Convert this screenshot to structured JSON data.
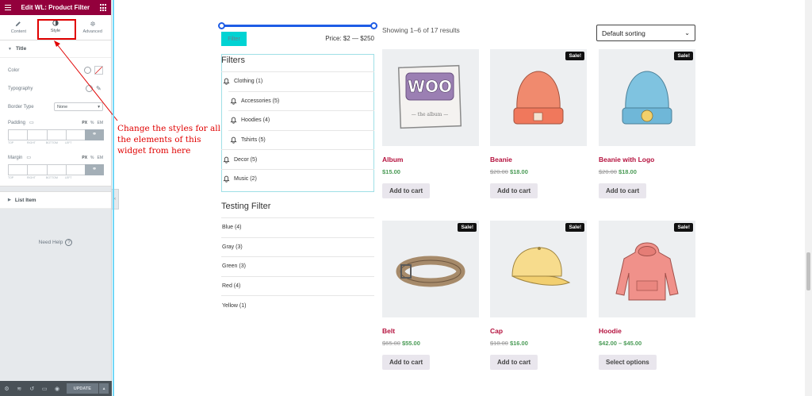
{
  "panel": {
    "title": "Edit WL: Product Filter",
    "tabs": [
      {
        "label": "Content",
        "icon": "pencil-icon"
      },
      {
        "label": "Style",
        "icon": "half-circle-icon"
      },
      {
        "label": "Advanced",
        "icon": "gear-icon"
      }
    ],
    "active_tab": "Style",
    "section_title": "Title",
    "controls": {
      "color": "Color",
      "typography": "Typography",
      "border_type": "Border Type",
      "border_value": "None",
      "padding": "Padding",
      "margin": "Margin",
      "unit_px": "PX",
      "unit_pct": "%",
      "unit_em": "EM",
      "dim_labels": [
        "TOP",
        "RIGHT",
        "BOTTOM",
        "LEFT"
      ]
    },
    "list_item": "List Item",
    "need_help": "Need Help",
    "update": "UPDATE",
    "accent": "#93003c"
  },
  "annotation": "Change the styles for all the elements of this widget from here",
  "filter": {
    "button": "Filter",
    "price": "Price: $2 — $250",
    "title": "Filters",
    "items": [
      {
        "label": "Clothing (1)",
        "sub": false
      },
      {
        "label": "Accessories (5)",
        "sub": true
      },
      {
        "label": "Hoodies (4)",
        "sub": true
      },
      {
        "label": "Tshirts (5)",
        "sub": true
      },
      {
        "label": "Decor (5)",
        "sub": false
      },
      {
        "label": "Music (2)",
        "sub": false
      }
    ],
    "testing_title": "Testing Filter",
    "testing_items": [
      "Blue (4)",
      "Gray (3)",
      "Green (3)",
      "Red (4)",
      "Yellow (1)"
    ]
  },
  "shop": {
    "result_count": "Showing 1–6 of 17 results",
    "sort": "Default sorting",
    "sale_label": "Sale!",
    "products": [
      {
        "name": "Album",
        "old_price": "",
        "price": "$15.00",
        "sale": false,
        "button": "Add to cart",
        "image": "album"
      },
      {
        "name": "Beanie",
        "old_price": "$20.00",
        "price": "$18.00",
        "sale": true,
        "button": "Add to cart",
        "image": "beanie"
      },
      {
        "name": "Beanie with Logo",
        "old_price": "$20.00",
        "price": "$18.00",
        "sale": true,
        "button": "Add to cart",
        "image": "beanie-logo"
      },
      {
        "name": "Belt",
        "old_price": "$65.00",
        "price": "$55.00",
        "sale": true,
        "button": "Add to cart",
        "image": "belt"
      },
      {
        "name": "Cap",
        "old_price": "$18.00",
        "price": "$16.00",
        "sale": true,
        "button": "Add to cart",
        "image": "cap"
      },
      {
        "name": "Hoodie",
        "old_price": "",
        "price": "$42.00 – $45.00",
        "sale": true,
        "button": "Select options",
        "image": "hoodie"
      }
    ]
  }
}
